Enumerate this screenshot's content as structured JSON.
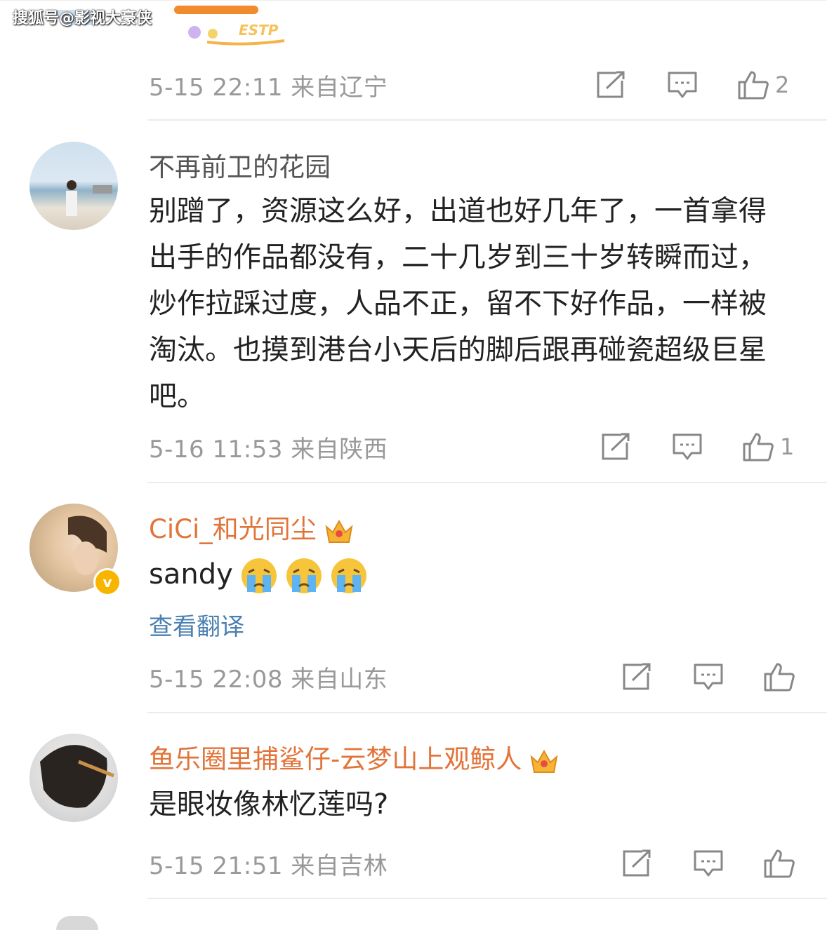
{
  "watermark": "搜狐号@影视大豪侠",
  "top_decor_text": "ESTP",
  "comments": [
    {
      "meta": "5-15 22:11 来自辽宁",
      "like_count": "2"
    },
    {
      "username": "不再前卫的花园",
      "content": "别蹭了，资源这么好，出道也好几年了，一首拿得出手的作品都没有，二十几岁到三十岁转瞬而过，炒作拉踩过度，人品不正，留不下好作品，一样被淘汰。也摸到港台小天后的脚后跟再碰瓷超级巨星吧。",
      "meta": "5-16 11:53 来自陕西",
      "like_count": "1"
    },
    {
      "username": "CiCi_和光同尘",
      "content": "sandy",
      "emoji_count": 3,
      "translate": "查看翻译",
      "meta": "5-15 22:08 来自山东",
      "like_count": "",
      "verified_badge": "v"
    },
    {
      "username": "鱼乐圈里捕鲨仔-云梦山上观鲸人",
      "content": "是眼妆像林忆莲吗?",
      "meta": "5-15 21:51 来自吉林",
      "like_count": ""
    }
  ],
  "colors": {
    "meta_gray": "#999999",
    "vip_name": "#e2743a",
    "translate_link": "#4a7fb0",
    "separator": "#ececec"
  },
  "icons": [
    "share-icon",
    "comment-icon",
    "like-icon",
    "crown-icon",
    "crying-emoji-icon"
  ]
}
